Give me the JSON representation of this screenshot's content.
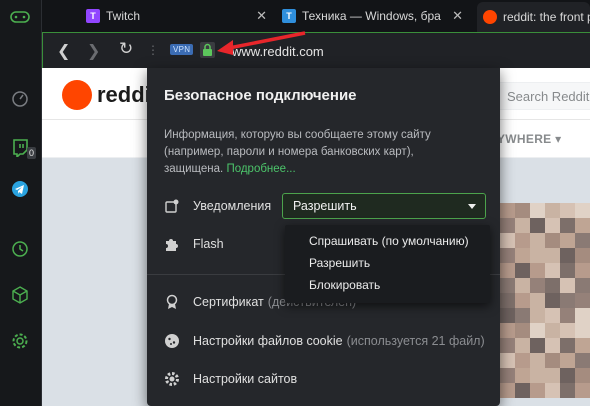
{
  "tabs": [
    {
      "label": "Twitch",
      "icon": "twitch-icon",
      "color": "#9146ff"
    },
    {
      "label": "Техника — Windows, бра",
      "icon": "telegraph-icon",
      "color": "#2f8fdc"
    },
    {
      "label": "reddit: the front p",
      "icon": "reddit-icon",
      "color": "#ff4500"
    }
  ],
  "toolbar": {
    "vpn_label": "VPN",
    "url": "www.reddit.com"
  },
  "reddit": {
    "wordmark": "reddi",
    "search_placeholder": "Search Reddit",
    "everywhere": "YWHERE ▾"
  },
  "sidebar": {
    "badge": "0",
    "items": [
      "speed-dial-icon",
      "twitch-icon",
      "telegram-icon",
      "history-icon",
      "extensions-icon",
      "settings-icon"
    ]
  },
  "popup": {
    "title": "Безопасное подключение",
    "description": "Информация, которую вы сообщаете этому сайту (например, пароли и номера банковских карт), защищена.",
    "more_link": "Подробнее...",
    "notifications_label": "Уведомления",
    "notifications_value": "Разрешить",
    "flash_label": "Flash",
    "certificate_label": "Сертификат",
    "certificate_status": "(действителен)",
    "cookies_label": "Настройки файлов cookie",
    "cookies_status": "(используется 21 файл)",
    "site_settings_label": "Настройки сайтов"
  },
  "dropdown": {
    "options": [
      "Спрашивать (по умолчанию)",
      "Разрешить",
      "Блокировать"
    ]
  },
  "colors": {
    "accent": "#4ca34c",
    "link": "#4cc46a",
    "arrow": "#e8262b"
  }
}
